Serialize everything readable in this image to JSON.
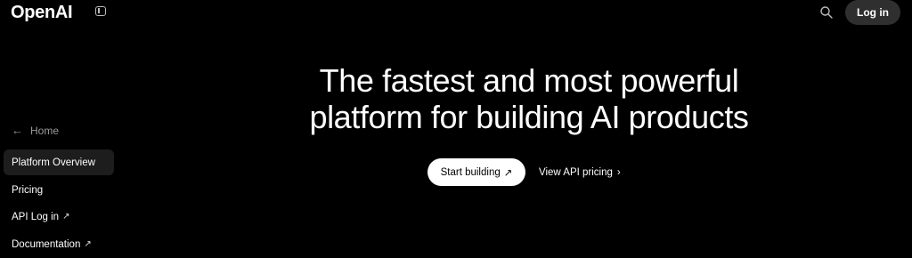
{
  "header": {
    "logo": "OpenAI",
    "login_label": "Log in",
    "icons": [
      "sidebar-toggle-icon",
      "search-icon"
    ]
  },
  "sidebar": {
    "back_label": "Home",
    "items": [
      {
        "label": "Platform Overview",
        "active": true,
        "external": false
      },
      {
        "label": "Pricing",
        "active": false,
        "external": false
      },
      {
        "label": "API Log in",
        "active": false,
        "external": true
      },
      {
        "label": "Documentation",
        "active": false,
        "external": true
      }
    ]
  },
  "hero": {
    "title_line1": "The fastest and most powerful",
    "title_line2": "platform for building AI products",
    "primary_cta": "Start building",
    "secondary_cta": "View API pricing"
  },
  "colors": {
    "background": "#000000",
    "text": "#ffffff",
    "active_nav_bg": "#1d1d1d",
    "login_bg": "#2f2f2f",
    "muted": "#9a9a9a"
  }
}
